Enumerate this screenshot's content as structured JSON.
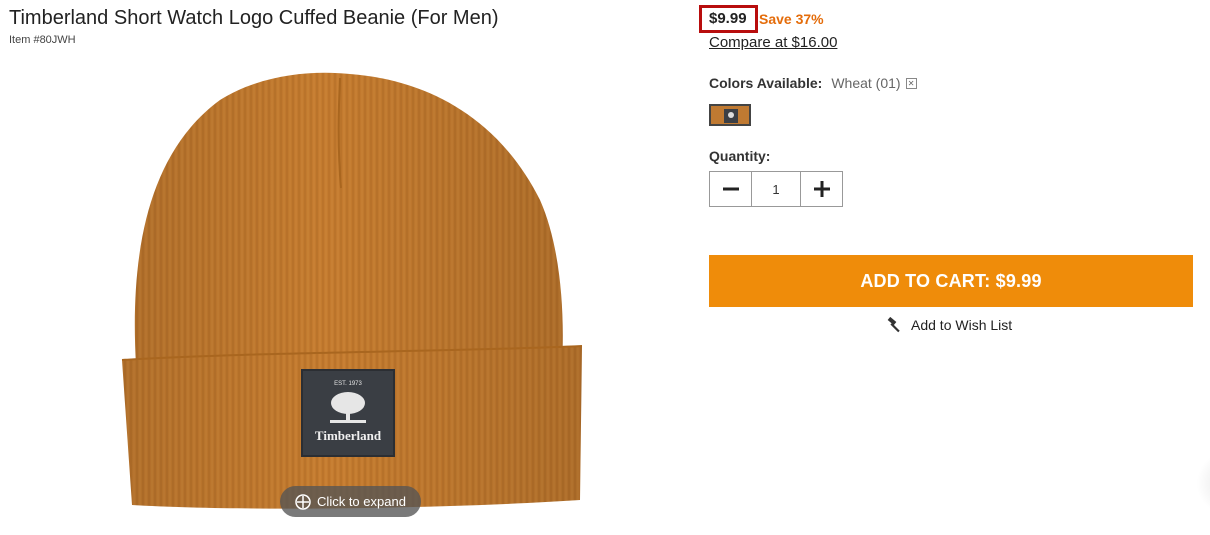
{
  "product": {
    "title": "Timberland Short Watch Logo Cuffed Beanie (For Men)",
    "item_number": "Item #80JWH"
  },
  "gallery": {
    "expand_label": "Click to expand",
    "expand_icon": "circle-plus-icon",
    "patch_est": "EST. 1973",
    "patch_brand": "Timberland"
  },
  "pricing": {
    "price": "$9.99",
    "save": "Save 37%",
    "compare": "Compare at $16.00",
    "highlight_color": "#b80d0d",
    "save_color": "#e46c0a"
  },
  "colors": {
    "label": "Colors Available:",
    "selected": "Wheat (01)",
    "clear_icon": "clear-x-icon",
    "swatch_color": "#c07a32"
  },
  "quantity": {
    "label": "Quantity:",
    "value": "1",
    "minus_icon": "minus-icon",
    "plus_icon": "plus-icon"
  },
  "cart": {
    "button_label": "ADD TO CART: $9.99",
    "button_color": "#ef8c0a"
  },
  "wishlist": {
    "label": "Add to Wish List",
    "icon": "hammer-icon"
  }
}
